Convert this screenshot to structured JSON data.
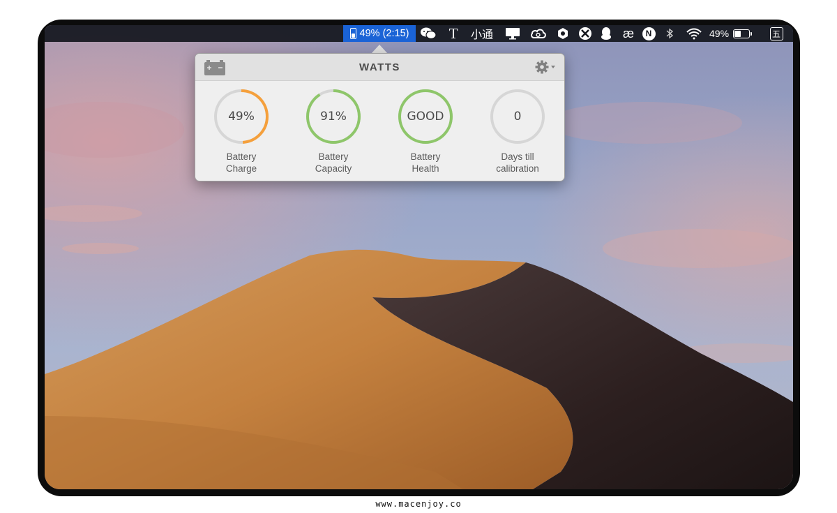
{
  "menubar": {
    "watts_status": "49% (2:15)",
    "text_tool_glyph": "T",
    "xiaotong_label": "小通",
    "ae_glyph": "æ",
    "n_glyph": "N",
    "battery_percent": "49%",
    "ime_label": "五"
  },
  "popover": {
    "title": "WATTS",
    "gauges": [
      {
        "value_text": "49%",
        "label_line1": "Battery",
        "label_line2": "Charge",
        "fraction": 0.49,
        "color": "#f5a03c"
      },
      {
        "value_text": "91%",
        "label_line1": "Battery",
        "label_line2": "Capacity",
        "fraction": 0.91,
        "color": "#8ec66a"
      },
      {
        "value_text": "GOOD",
        "label_line1": "Battery",
        "label_line2": "Health",
        "fraction": 1.0,
        "color": "#8ec66a"
      },
      {
        "value_text": "0",
        "label_line1": "Days till",
        "label_line2": "calibration",
        "fraction": 0.0,
        "color": "#d6d6d6"
      }
    ]
  },
  "footer": {
    "watermark": "www.macenjoy.co"
  },
  "colors": {
    "accent_selected": "#1a63d6",
    "track": "#d6d6d6"
  },
  "icons": [
    "battery-menubar-icon",
    "wechat-icon",
    "text-tool-icon",
    "display-icon",
    "creative-cloud-icon",
    "shield-icon",
    "crossover-icon",
    "qq-penguin-icon",
    "bluetooth-icon",
    "wifi-icon",
    "battery-icon",
    "battery-header-icon",
    "gear-icon"
  ]
}
